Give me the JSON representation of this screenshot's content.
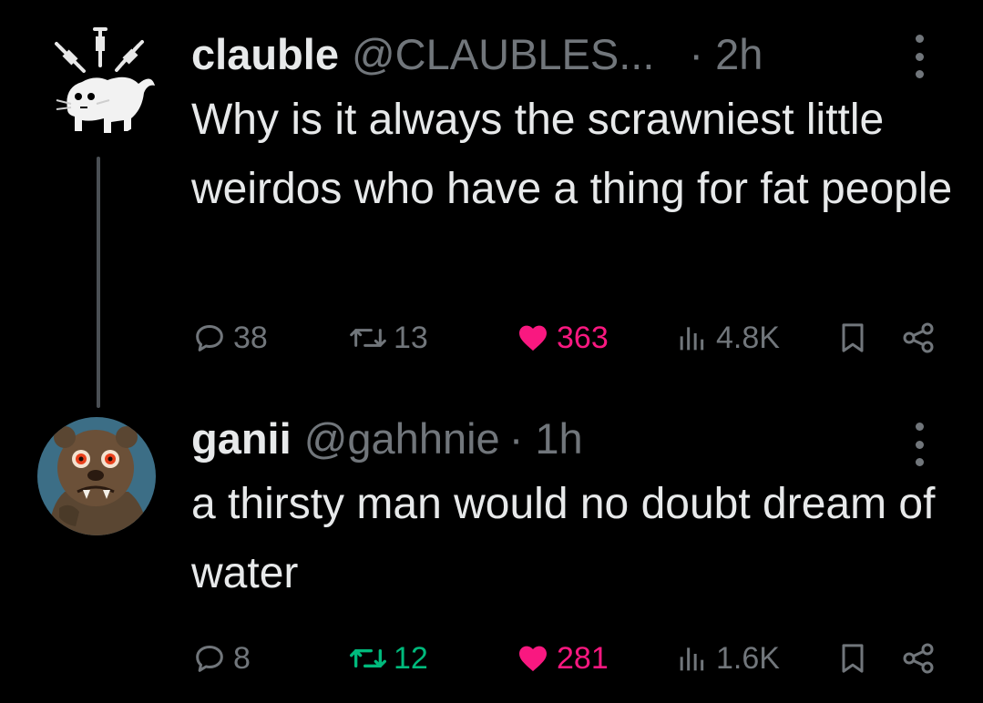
{
  "colors": {
    "background": "#000000",
    "text_primary": "#e7e9ea",
    "text_secondary": "#71767b",
    "like": "#f91880",
    "retweet": "#00ba7c",
    "thread_line": "#4a4f54"
  },
  "tweets": [
    {
      "display_name": "clauble",
      "handle": "@CLAUBLES...",
      "time": "· 2h",
      "text": "Why is it always the scrawniest little weirdos who have a thing for fat people",
      "avatar_icon": "cat-syringes-avatar-icon",
      "stats": {
        "replies": "38",
        "retweets": "13",
        "likes": "363",
        "views": "4.8K"
      },
      "liked": true,
      "retweeted": false
    },
    {
      "display_name": "ganii",
      "handle": "@gahhnie",
      "time": "· 1h",
      "text": "a thirsty man would no doubt dream of water",
      "avatar_icon": "bear-creature-avatar-icon",
      "stats": {
        "replies": "8",
        "retweets": "12",
        "likes": "281",
        "views": "1.6K"
      },
      "liked": true,
      "retweeted": true
    }
  ]
}
